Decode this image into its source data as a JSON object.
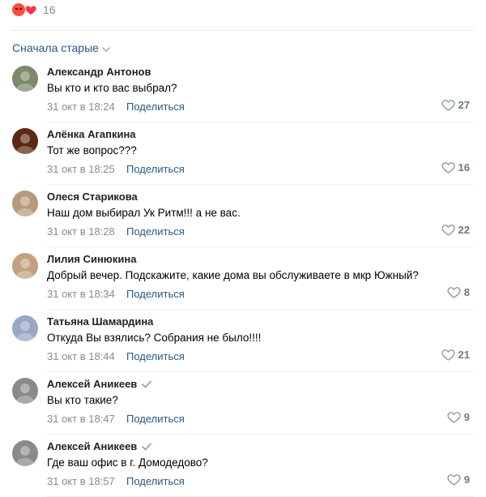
{
  "reactions": {
    "count": "16",
    "icons": [
      "angry-emoji-icon",
      "heart-reaction-icon"
    ],
    "colors": {
      "angry": "#ff4b3e",
      "heart": "#ff3347"
    }
  },
  "sort": {
    "label": "Сначала старые"
  },
  "colors": {
    "link": "#2a5885",
    "meta": "#818c99",
    "like": "#6d7885"
  },
  "comments": [
    {
      "author": "Александр Антонов",
      "verified": false,
      "text": "Вы кто и кто вас выбрал?",
      "time": "31 окт в 18:24",
      "share": "Поделиться",
      "likes": "27",
      "avatar_color": "#7a8a6a"
    },
    {
      "author": "Алёнка Агапкина",
      "verified": false,
      "text": "Тот же вопрос???",
      "time": "31 окт в 18:25",
      "share": "Поделиться",
      "likes": "16",
      "avatar_color": "#5a2a14"
    },
    {
      "author": "Олеся Старикова",
      "verified": false,
      "text": "Наш дом выбирал Ук Ритм!!! а не вас.",
      "time": "31 окт в 18:28",
      "share": "Поделиться",
      "likes": "22",
      "avatar_color": "#b89a7a"
    },
    {
      "author": "Лилия Синюкина",
      "verified": false,
      "text": "Добрый вечер. Подскажите, какие дома вы обслуживаете в мкр Южный?",
      "time": "31 окт в 18:34",
      "share": "Поделиться",
      "likes": "8",
      "avatar_color": "#c4a080"
    },
    {
      "author": "Татьяна Шамардина",
      "verified": false,
      "text": "Откуда Вы взялись? Собрания не было!!!!",
      "time": "31 окт в 18:44",
      "share": "Поделиться",
      "likes": "21",
      "avatar_color": "#9aa6c6"
    },
    {
      "author": "Алексей Аникеев",
      "verified": true,
      "text": "Вы кто такие?",
      "time": "31 окт в 18:47",
      "share": "Поделиться",
      "likes": "9",
      "avatar_color": "#8a8a8a"
    },
    {
      "author": "Алексей Аникеев",
      "verified": true,
      "text": "Где ваш офис в г. Домодедово?",
      "time": "31 окт в 18:57",
      "share": "Поделиться",
      "likes": "9",
      "avatar_color": "#8a8a8a"
    }
  ]
}
